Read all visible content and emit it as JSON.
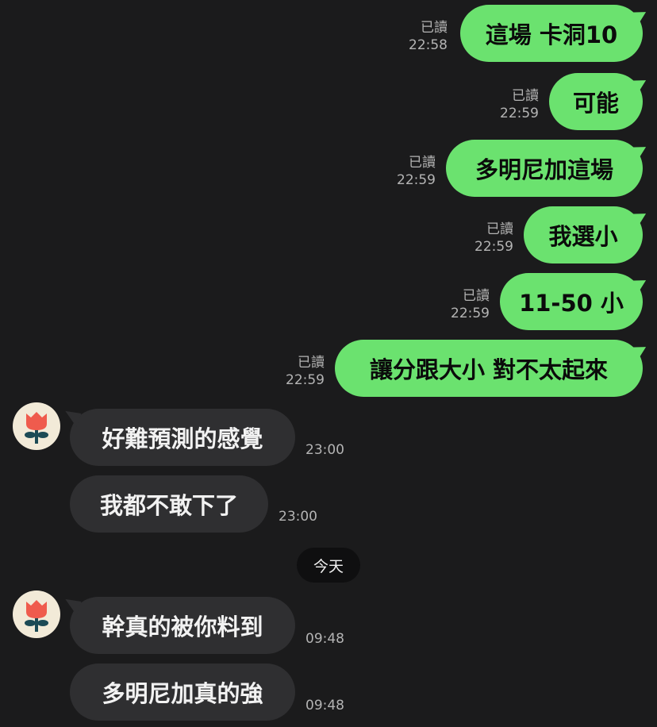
{
  "colors": {
    "background": "#1b1b1c",
    "outgoing_bubble": "#6be26f",
    "incoming_bubble": "#2f2f31",
    "avatar_flower": "#ef5b4d",
    "avatar_stem": "#1c4a55"
  },
  "messages": [
    {
      "dir": "out",
      "text": "這場 卡洞10",
      "read": "已讀",
      "time": "22:58"
    },
    {
      "dir": "out",
      "text": "可能",
      "read": "已讀",
      "time": "22:59"
    },
    {
      "dir": "out",
      "text": "多明尼加這場",
      "read": "已讀",
      "time": "22:59"
    },
    {
      "dir": "out",
      "text": "我選小",
      "read": "已讀",
      "time": "22:59"
    },
    {
      "dir": "out",
      "text": "11-50 小",
      "read": "已讀",
      "time": "22:59"
    },
    {
      "dir": "out",
      "text": "讓分跟大小 對不太起來",
      "read": "已讀",
      "time": "22:59"
    },
    {
      "dir": "in",
      "text": "好難預測的感覺",
      "time": "23:00",
      "avatar": "flower-avatar"
    },
    {
      "dir": "in",
      "text": "我都不敢下了",
      "time": "23:00"
    },
    {
      "dir": "in",
      "text": "幹真的被你料到",
      "time": "09:48",
      "avatar": "flower-avatar"
    },
    {
      "dir": "in",
      "text": "多明尼加真的強",
      "time": "09:48"
    }
  ],
  "date_divider": "今天"
}
